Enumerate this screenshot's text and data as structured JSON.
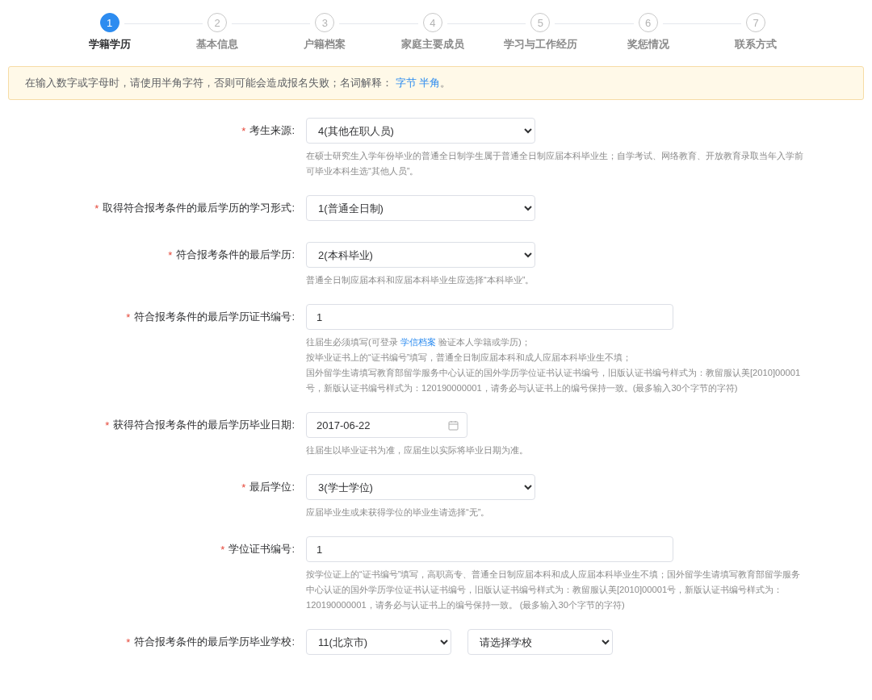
{
  "steps": [
    {
      "number": "1",
      "label": "学籍学历",
      "selected": true
    },
    {
      "number": "2",
      "label": "基本信息",
      "selected": false
    },
    {
      "number": "3",
      "label": "户籍档案",
      "selected": false
    },
    {
      "number": "4",
      "label": "家庭主要成员",
      "selected": false
    },
    {
      "number": "5",
      "label": "学习与工作经历",
      "selected": false
    },
    {
      "number": "6",
      "label": "奖惩情况",
      "selected": false
    },
    {
      "number": "7",
      "label": "联系方式",
      "selected": false
    }
  ],
  "notice": {
    "text": "在输入数字或字母时，请使用半角字符，否则可能会造成报名失败；名词解释：",
    "links": [
      "字节",
      "半角"
    ],
    "end": "。"
  },
  "fields": [
    {
      "mark": "*",
      "label": "考生来源:",
      "kind": "select",
      "values": [
        "4(其他在职人员)"
      ],
      "hint": [
        {
          "text": "在硕士研究生入学年份毕业的普通全日制学生属于普通全日制应届本科毕业生；自学考试、网络教育、开放教育录取当年入学前可毕业本科生选“其他人员”。"
        }
      ]
    },
    {
      "mark": "*",
      "label": "取得符合报考条件的最后学历的学习形式:",
      "kind": "select",
      "values": [
        "1(普通全日制)"
      ]
    },
    {
      "mark": "*",
      "label": "符合报考条件的最后学历:",
      "kind": "select",
      "values": [
        "2(本科毕业)"
      ],
      "hint": [
        {
          "text": "普通全日制应届本科和应届本科毕业生应选择“本科毕业”。"
        }
      ]
    },
    {
      "mark": "*",
      "label": "符合报考条件的最后学历证书编号:",
      "kind": "input",
      "values": [
        "1"
      ],
      "hint": [
        {
          "text": "往届生必须填写(可登录",
          "link": "学信档案",
          "after": "验证本人学籍或学历)；"
        },
        {
          "text": "按毕业证书上的“证书编号”填写，普通全日制应届本科和成人应届本科毕业生不填；"
        },
        {
          "text": "国外留学生请填写教育部留学服务中心认证的国外学历学位证书认证书编号，旧版认证书编号样式为：教留服认美[2010]00001号，新版认证书编号样式为：120190000001，请务必与认证书上的编号保持一致。(最多输入30个字节的字符)"
        }
      ]
    },
    {
      "mark": "*",
      "label": "获得符合报考条件的最后学历毕业日期:",
      "kind": "date",
      "values": [
        "2017-06-22"
      ],
      "hint": [
        {
          "text": "往届生以毕业证书为准，应届生以实际将毕业日期为准。"
        }
      ]
    },
    {
      "mark": "*",
      "label": "最后学位:",
      "kind": "select",
      "values": [
        "3(学士学位)"
      ],
      "hint": [
        {
          "text": "应届毕业生或未获得学位的毕业生请选择“无”。"
        }
      ]
    },
    {
      "mark": "*",
      "label": "学位证书编号:",
      "kind": "input",
      "values": [
        "1"
      ],
      "hint": [
        {
          "text": "按学位证上的“证书编号”填写，高职高专、普通全日制应届本科和成人应届本科毕业生不填；国外留学生请填写教育部留学服务中心认证的国外学历学位证书认证书编号，旧版认证书编号样式为：教留服认美[2010]00001号，新版认证书编号样式为：120190000001，请务必与认证书上的编号保持一致。 (最多输入30个字节的字符)"
        }
      ]
    },
    {
      "mark": "*",
      "label": "符合报考条件的最后学历毕业学校:",
      "kind": "double-select",
      "values": [
        "11(北京市)",
        "请选择学校"
      ]
    }
  ]
}
